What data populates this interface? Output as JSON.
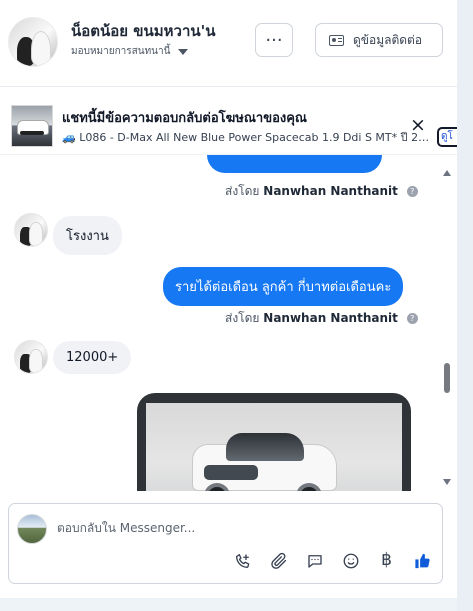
{
  "header": {
    "name": "น็อตน้อย ขนมหวาน'น",
    "assign_label": "มอบหมายการสนทนานี้",
    "more_label": "···",
    "contact_button_label": "ดูข้อมูลติดต่อ"
  },
  "ad_banner": {
    "title": "แชทนี้มีข้อความตอบกลับต่อโฆษณาของคุณ",
    "subtitle": "🚙 L086 - D-Max All New Blue Power Spacecab 1.9 Ddi S MT* ปี 20...",
    "close_label": "×",
    "view_label": "ดูโ"
  },
  "messages": {
    "sentby_1_prefix": "ส่งโดย",
    "sentby_1_name": "Nanwhan Nanthanit",
    "incoming_1": "โรงงาน",
    "outgoing_1": "รายได้ต่อเดือน  ลูกค้า กี่บาทต่อเดือนคะ",
    "sentby_2_prefix": "ส่งโดย",
    "sentby_2_name": "Nanwhan Nanthanit",
    "incoming_2": "12000+"
  },
  "composer": {
    "placeholder": "ตอบกลับใน Messenger..."
  },
  "icons": {
    "info": "info-icon",
    "phone": "phone-plus-icon",
    "attachment": "paperclip-icon",
    "saved_reply": "chat-bubble-icon",
    "emoji": "smiley-icon",
    "payment": "baht-icon",
    "like": "thumbs-up-icon"
  },
  "colors": {
    "accent": "#1678f2",
    "like": "#0f5bd8"
  }
}
